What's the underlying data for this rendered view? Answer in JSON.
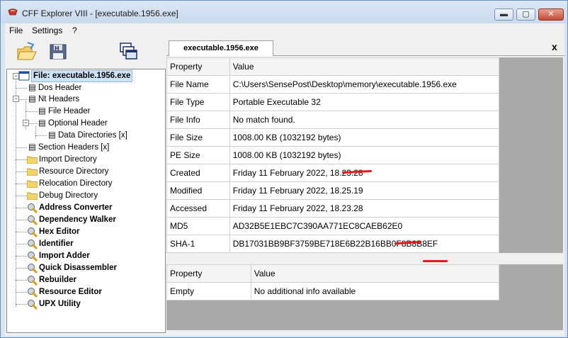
{
  "window": {
    "title": "CFF Explorer VIII - [executable.1956.exe]",
    "min_label": "▬",
    "max_label": "▢",
    "close_label": "✕"
  },
  "menu": {
    "items": [
      "File",
      "Settings",
      "?"
    ]
  },
  "toolbar": {
    "icons": [
      "open-folder-icon",
      "save-disk-icon",
      "windows-icon"
    ]
  },
  "tree": {
    "root": "File: executable.1956.exe",
    "items": [
      {
        "label": "Dos Header",
        "icon": "page-icon"
      },
      {
        "label": "Nt Headers",
        "icon": "page-icon"
      },
      {
        "label": "File Header",
        "icon": "page-icon"
      },
      {
        "label": "Optional Header",
        "icon": "page-icon"
      },
      {
        "label": "Data Directories [x]",
        "icon": "page-icon"
      },
      {
        "label": "Section Headers [x]",
        "icon": "page-icon"
      },
      {
        "label": "Import Directory",
        "icon": "folder-icon"
      },
      {
        "label": "Resource Directory",
        "icon": "folder-icon"
      },
      {
        "label": "Relocation Directory",
        "icon": "folder-icon"
      },
      {
        "label": "Debug Directory",
        "icon": "folder-icon"
      },
      {
        "label": "Address Converter",
        "icon": "tool-icon"
      },
      {
        "label": "Dependency Walker",
        "icon": "tool-icon"
      },
      {
        "label": "Hex Editor",
        "icon": "tool-icon"
      },
      {
        "label": "Identifier",
        "icon": "tool-icon"
      },
      {
        "label": "Import Adder",
        "icon": "tool-icon"
      },
      {
        "label": "Quick Disassembler",
        "icon": "tool-icon"
      },
      {
        "label": "Rebuilder",
        "icon": "tool-icon"
      },
      {
        "label": "Resource Editor",
        "icon": "tool-icon"
      },
      {
        "label": "UPX Utility",
        "icon": "tool-icon"
      }
    ]
  },
  "tab": {
    "label": "executable.1956.exe",
    "close_label": "x"
  },
  "props": {
    "headers": [
      "Property",
      "Value"
    ],
    "rows": [
      [
        "File Name",
        "C:\\Users\\SensePost\\Desktop\\memory\\executable.1956.exe"
      ],
      [
        "File Type",
        "Portable Executable 32"
      ],
      [
        "File Info",
        "No match found."
      ],
      [
        "File Size",
        "1008.00 KB (1032192 bytes)"
      ],
      [
        "PE Size",
        "1008.00 KB (1032192 bytes)"
      ],
      [
        "Created",
        "Friday 11 February 2022, 18.23.28"
      ],
      [
        "Modified",
        "Friday 11 February 2022, 18.25.19"
      ],
      [
        "Accessed",
        "Friday 11 February 2022, 18.23.28"
      ],
      [
        "MD5",
        "AD32B5E1EBC7C390AA771EC8CAEB62E0"
      ],
      [
        "SHA-1",
        "DB17031BB9BF3759BE718E6B22B16BB0F8B8B8EF"
      ]
    ]
  },
  "info": {
    "headers": [
      "Property",
      "Value"
    ],
    "rows": [
      [
        "Empty",
        "No additional info available"
      ]
    ]
  },
  "colors": {
    "annotation": "#e21a1a",
    "selection": "#cde3f7"
  }
}
